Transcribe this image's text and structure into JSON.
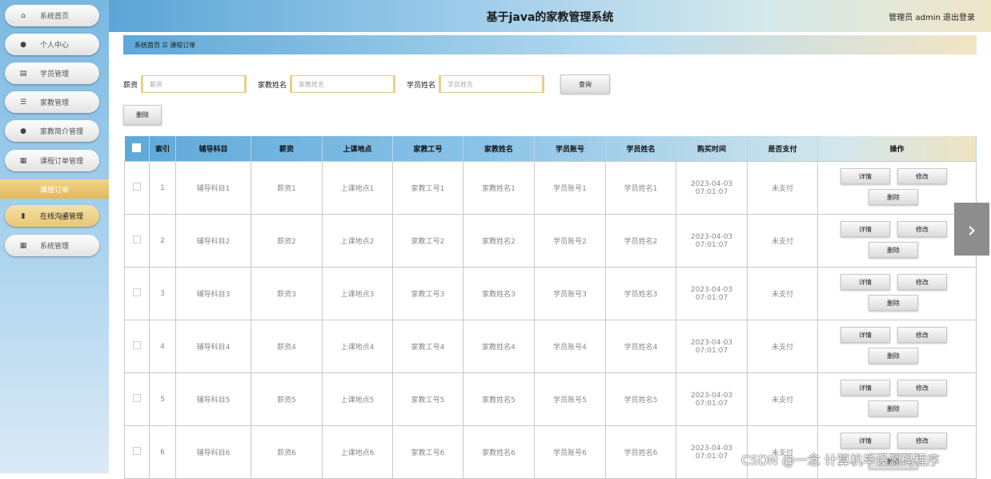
{
  "app": {
    "title": "基于java的家教管理系统",
    "user_info": "管理员 admin  退出登录"
  },
  "sidebar": {
    "items": [
      {
        "label": "系统首页",
        "icon": "home-icon",
        "glyph": "⌂"
      },
      {
        "label": "个人中心",
        "icon": "user-icon",
        "glyph": "●"
      },
      {
        "label": "学员管理",
        "icon": "document-icon",
        "glyph": "▤"
      },
      {
        "label": "家教管理",
        "icon": "sliders-icon",
        "glyph": "☰"
      },
      {
        "label": "家教简介管理",
        "icon": "person-icon",
        "glyph": "●"
      },
      {
        "label": "课程订单管理",
        "icon": "grid-icon",
        "glyph": "▦"
      },
      {
        "label": "在线沟通管理",
        "icon": "book-icon",
        "glyph": "▮"
      },
      {
        "label": "系统管理",
        "icon": "apps-icon",
        "glyph": "▦"
      }
    ],
    "submenu_label": "课程订单"
  },
  "breadcrumb": "系统首页 ☰ 课程订单",
  "filters": {
    "salary_label": "薪资",
    "salary_placeholder": "薪资",
    "tutor_name_label": "家教姓名",
    "tutor_name_placeholder": "家教姓名",
    "student_name_label": "学员姓名",
    "student_name_placeholder": "学员姓名",
    "search_button": "查询"
  },
  "delete_button": "删除",
  "table": {
    "headers": [
      "",
      "索引",
      "辅导科目",
      "薪资",
      "上课地点",
      "家教工号",
      "家教姓名",
      "学员账号",
      "学员姓名",
      "购买时间",
      "是否支付",
      "操作"
    ],
    "actions": {
      "detail": "详情",
      "edit": "修改",
      "delete": "删除"
    },
    "rows": [
      {
        "index": "1",
        "subject": "辅导科目1",
        "salary": "薪资1",
        "location": "上课地点1",
        "tutor_id": "家教工号1",
        "tutor_name": "家教姓名1",
        "student_account": "学员账号1",
        "student_name": "学员姓名1",
        "time": "2023-04-03 07:01:07",
        "paid": "未支付"
      },
      {
        "index": "2",
        "subject": "辅导科目2",
        "salary": "薪资2",
        "location": "上课地点2",
        "tutor_id": "家教工号2",
        "tutor_name": "家教姓名2",
        "student_account": "学员账号2",
        "student_name": "学员姓名2",
        "time": "2023-04-03 07:01:07",
        "paid": "未支付"
      },
      {
        "index": "3",
        "subject": "辅导科目3",
        "salary": "薪资3",
        "location": "上课地点3",
        "tutor_id": "家教工号3",
        "tutor_name": "家教姓名3",
        "student_account": "学员账号3",
        "student_name": "学员姓名3",
        "time": "2023-04-03 07:01:07",
        "paid": "未支付"
      },
      {
        "index": "4",
        "subject": "辅导科目4",
        "salary": "薪资4",
        "location": "上课地点4",
        "tutor_id": "家教工号4",
        "tutor_name": "家教姓名4",
        "student_account": "学员账号4",
        "student_name": "学员姓名4",
        "time": "2023-04-03 07:01:07",
        "paid": "未支付"
      },
      {
        "index": "5",
        "subject": "辅导科目5",
        "salary": "薪资5",
        "location": "上课地点5",
        "tutor_id": "家教工号5",
        "tutor_name": "家教姓名5",
        "student_account": "学员账号5",
        "student_name": "学员姓名5",
        "time": "2023-04-03 07:01:07",
        "paid": "未支付"
      },
      {
        "index": "6",
        "subject": "辅导科目6",
        "salary": "薪资6",
        "location": "上课地点6",
        "tutor_id": "家教工号6",
        "tutor_name": "家教姓名6",
        "student_account": "学员账号6",
        "student_name": "学员姓名6",
        "time": "2023-04-03 07:01:07",
        "paid": "未支付"
      }
    ]
  },
  "watermark": "CSDN @一念 计算机毕设源码程序"
}
